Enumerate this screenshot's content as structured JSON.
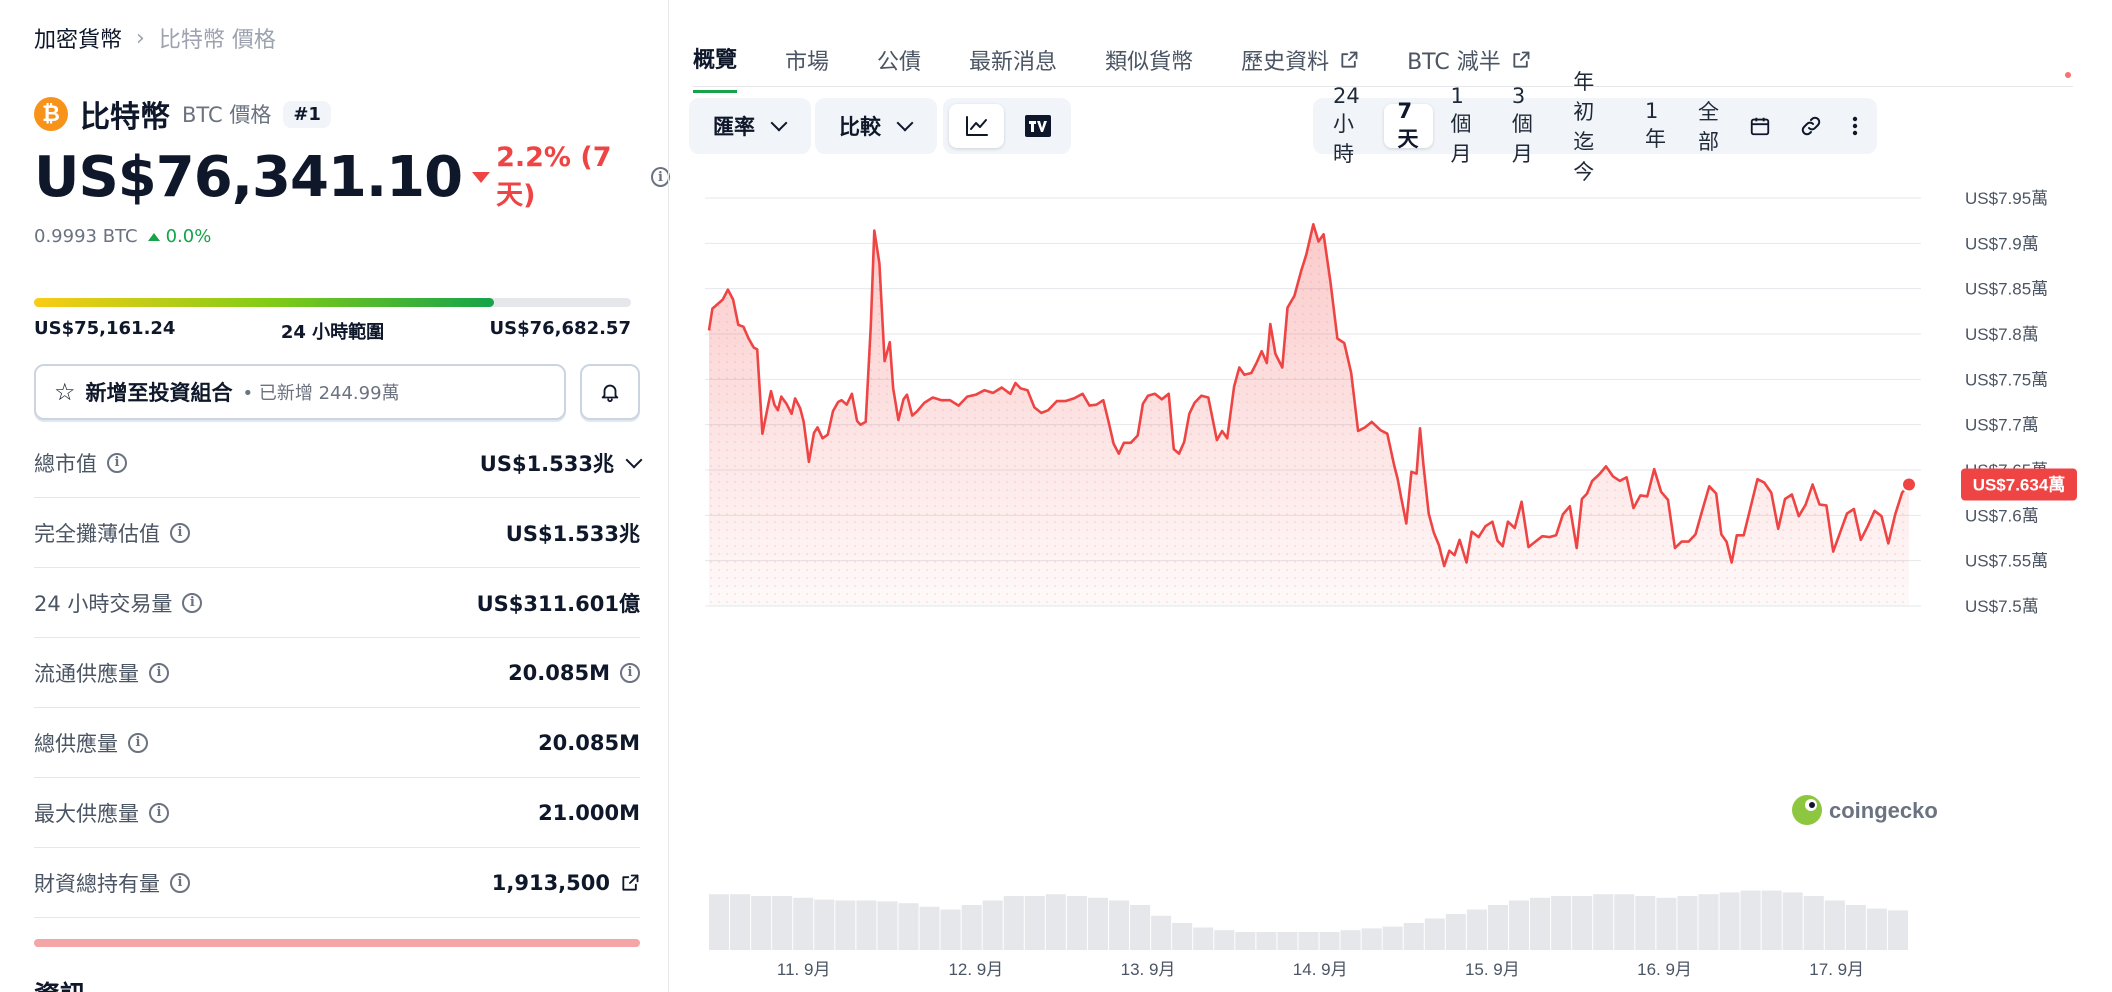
{
  "breadcrumb": {
    "root": "加密貨幣",
    "current": "比特幣 價格"
  },
  "coin": {
    "name": "比特幣",
    "symbol_label": "BTC 價格",
    "rank": "#1",
    "logo_glyph": "₿",
    "logo_color": "#f7931a"
  },
  "price": {
    "value": "US$76,341.10",
    "change": "2.2% (7天)",
    "change_color": "#ef4444"
  },
  "btc_price": {
    "value": "0.9993 BTC",
    "change": "0.0%",
    "change_color": "#16a34a"
  },
  "range_24h": {
    "low": "US$75,161.24",
    "label": "24 小時範圍",
    "high": "US$76,682.57",
    "position": 0.77
  },
  "portfolio": {
    "label": "新增至投資組合",
    "sub": "• 已新增 244.99萬"
  },
  "stats": [
    {
      "label": "總市值",
      "value": "US$1.533兆"
    },
    {
      "label": "完全攤薄估值",
      "value": "US$1.533兆"
    },
    {
      "label": "24 小時交易量",
      "value": "US$311.601億"
    },
    {
      "label": "流通供應量",
      "value": "20.085M"
    },
    {
      "label": "總供應量",
      "value": "20.085M"
    },
    {
      "label": "最大供應量",
      "value": "21.000M"
    },
    {
      "label": "財資總持有量",
      "value": "1,913,500"
    }
  ],
  "info_title": "資訊",
  "tabs": [
    {
      "label": "概覽",
      "active": true
    },
    {
      "label": "市場"
    },
    {
      "label": "公債"
    },
    {
      "label": "最新消息"
    },
    {
      "label": "類似貨幣"
    },
    {
      "label": "歷史資料",
      "external": true
    },
    {
      "label": "BTC 減半",
      "external": true
    }
  ],
  "controls": {
    "rate_label": "匯率",
    "compare_label": "比較",
    "chart_types": [
      "line-chart-icon",
      "tradingview-icon"
    ],
    "ranges": [
      "24小時",
      "7天",
      "1 個月",
      "3 個月",
      "年初迄今",
      "1年",
      "全部"
    ],
    "selected_range": "7天"
  },
  "chart_data": {
    "type": "area",
    "y_unit": "萬 USD",
    "ylim": [
      7.5,
      7.95
    ],
    "y_ticks": [
      "US$7.95萬",
      "US$7.9萬",
      "US$7.85萬",
      "US$7.8萬",
      "US$7.75萬",
      "US$7.7萬",
      "US$7.65萬",
      "US$7.6萬",
      "US$7.55萬",
      "US$7.5萬"
    ],
    "y_tick_values": [
      7.95,
      7.9,
      7.85,
      7.8,
      7.75,
      7.7,
      7.65,
      7.6,
      7.55,
      7.5
    ],
    "x_ticks": [
      "11. 9月",
      "12. 9月",
      "13. 9月",
      "14. 9月",
      "15. 9月",
      "16. 9月",
      "17. 9月"
    ],
    "x_tick_days": [
      11,
      12,
      13,
      14,
      15,
      16,
      17
    ],
    "x_range_days": [
      10.45,
      17.42
    ],
    "current_label": "US$7.634萬",
    "current_value": 7.634,
    "line_color": "#ef4444",
    "watermark": "coingecko",
    "series": [
      {
        "values": [
          [
            10.45,
            7.804
          ],
          [
            10.47,
            7.828
          ],
          [
            10.5,
            7.833
          ],
          [
            10.53,
            7.838
          ],
          [
            10.56,
            7.849
          ],
          [
            10.59,
            7.838
          ],
          [
            10.62,
            7.81
          ],
          [
            10.65,
            7.808
          ],
          [
            10.68,
            7.795
          ],
          [
            10.71,
            7.785
          ],
          [
            10.73,
            7.783
          ],
          [
            10.76,
            7.69
          ],
          [
            10.79,
            7.718
          ],
          [
            10.81,
            7.737
          ],
          [
            10.83,
            7.722
          ],
          [
            10.85,
            7.716
          ],
          [
            10.87,
            7.731
          ],
          [
            10.9,
            7.723
          ],
          [
            10.93,
            7.712
          ],
          [
            10.95,
            7.729
          ],
          [
            10.98,
            7.718
          ],
          [
            11.0,
            7.703
          ],
          [
            11.03,
            7.659
          ],
          [
            11.06,
            7.691
          ],
          [
            11.08,
            7.697
          ],
          [
            11.11,
            7.685
          ],
          [
            11.14,
            7.689
          ],
          [
            11.17,
            7.715
          ],
          [
            11.2,
            7.725
          ],
          [
            11.22,
            7.727
          ],
          [
            11.25,
            7.722
          ],
          [
            11.28,
            7.734
          ],
          [
            11.31,
            7.704
          ],
          [
            11.33,
            7.7
          ],
          [
            11.36,
            7.703
          ],
          [
            11.39,
            7.809
          ],
          [
            11.41,
            7.914
          ],
          [
            11.44,
            7.878
          ],
          [
            11.47,
            7.77
          ],
          [
            11.5,
            7.791
          ],
          [
            11.52,
            7.74
          ],
          [
            11.55,
            7.705
          ],
          [
            11.58,
            7.728
          ],
          [
            11.6,
            7.733
          ],
          [
            11.63,
            7.71
          ],
          [
            11.66,
            7.715
          ],
          [
            11.7,
            7.724
          ],
          [
            11.75,
            7.73
          ],
          [
            11.8,
            7.727
          ],
          [
            11.85,
            7.727
          ],
          [
            11.9,
            7.721
          ],
          [
            11.95,
            7.731
          ],
          [
            12.0,
            7.733
          ],
          [
            12.05,
            7.738
          ],
          [
            12.1,
            7.735
          ],
          [
            12.15,
            7.741
          ],
          [
            12.2,
            7.734
          ],
          [
            12.23,
            7.746
          ],
          [
            12.26,
            7.74
          ],
          [
            12.3,
            7.738
          ],
          [
            12.34,
            7.719
          ],
          [
            12.38,
            7.713
          ],
          [
            12.42,
            7.716
          ],
          [
            12.47,
            7.726
          ],
          [
            12.52,
            7.726
          ],
          [
            12.57,
            7.729
          ],
          [
            12.62,
            7.734
          ],
          [
            12.66,
            7.721
          ],
          [
            12.7,
            7.722
          ],
          [
            12.74,
            7.727
          ],
          [
            12.77,
            7.704
          ],
          [
            12.8,
            7.679
          ],
          [
            12.83,
            7.668
          ],
          [
            12.86,
            7.68
          ],
          [
            12.9,
            7.68
          ],
          [
            12.94,
            7.688
          ],
          [
            12.97,
            7.723
          ],
          [
            13.0,
            7.732
          ],
          [
            13.04,
            7.734
          ],
          [
            13.08,
            7.728
          ],
          [
            13.12,
            7.734
          ],
          [
            13.15,
            7.673
          ],
          [
            13.18,
            7.668
          ],
          [
            13.21,
            7.681
          ],
          [
            13.24,
            7.712
          ],
          [
            13.27,
            7.724
          ],
          [
            13.31,
            7.732
          ],
          [
            13.35,
            7.73
          ],
          [
            13.4,
            7.683
          ],
          [
            13.43,
            7.693
          ],
          [
            13.46,
            7.685
          ],
          [
            13.5,
            7.742
          ],
          [
            13.53,
            7.763
          ],
          [
            13.56,
            7.755
          ],
          [
            13.6,
            7.757
          ],
          [
            13.63,
            7.768
          ],
          [
            13.66,
            7.781
          ],
          [
            13.69,
            7.768
          ],
          [
            13.71,
            7.811
          ],
          [
            13.74,
            7.778
          ],
          [
            13.78,
            7.763
          ],
          [
            13.81,
            7.829
          ],
          [
            13.85,
            7.842
          ],
          [
            13.89,
            7.87
          ],
          [
            13.92,
            7.888
          ],
          [
            13.96,
            7.921
          ],
          [
            13.99,
            7.902
          ],
          [
            14.02,
            7.91
          ],
          [
            14.06,
            7.857
          ],
          [
            14.1,
            7.795
          ],
          [
            14.14,
            7.79
          ],
          [
            14.18,
            7.757
          ],
          [
            14.22,
            7.693
          ],
          [
            14.26,
            7.697
          ],
          [
            14.3,
            7.703
          ],
          [
            14.35,
            7.694
          ],
          [
            14.39,
            7.69
          ],
          [
            14.43,
            7.655
          ],
          [
            14.45,
            7.64
          ],
          [
            14.47,
            7.62
          ],
          [
            14.5,
            7.591
          ],
          [
            14.53,
            7.648
          ],
          [
            14.56,
            7.646
          ],
          [
            14.58,
            7.696
          ],
          [
            14.6,
            7.655
          ],
          [
            14.63,
            7.602
          ],
          [
            14.66,
            7.581
          ],
          [
            14.69,
            7.567
          ],
          [
            14.72,
            7.544
          ],
          [
            14.75,
            7.561
          ],
          [
            14.78,
            7.556
          ],
          [
            14.81,
            7.573
          ],
          [
            14.85,
            7.548
          ],
          [
            14.88,
            7.582
          ],
          [
            14.92,
            7.576
          ],
          [
            14.96,
            7.588
          ],
          [
            15.0,
            7.593
          ],
          [
            15.03,
            7.572
          ],
          [
            15.06,
            7.566
          ],
          [
            15.09,
            7.593
          ],
          [
            15.13,
            7.586
          ],
          [
            15.17,
            7.615
          ],
          [
            15.21,
            7.565
          ],
          [
            15.25,
            7.571
          ],
          [
            15.29,
            7.577
          ],
          [
            15.33,
            7.576
          ],
          [
            15.37,
            7.578
          ],
          [
            15.41,
            7.601
          ],
          [
            15.45,
            7.61
          ],
          [
            15.49,
            7.564
          ],
          [
            15.52,
            7.618
          ],
          [
            15.55,
            7.624
          ],
          [
            15.58,
            7.638
          ],
          [
            15.62,
            7.645
          ],
          [
            15.66,
            7.654
          ],
          [
            15.7,
            7.643
          ],
          [
            15.74,
            7.638
          ],
          [
            15.78,
            7.642
          ],
          [
            15.82,
            7.608
          ],
          [
            15.86,
            7.622
          ],
          [
            15.9,
            7.621
          ],
          [
            15.94,
            7.651
          ],
          [
            15.98,
            7.626
          ],
          [
            16.02,
            7.617
          ],
          [
            16.06,
            7.564
          ],
          [
            16.1,
            7.571
          ],
          [
            16.14,
            7.571
          ],
          [
            16.18,
            7.579
          ],
          [
            16.22,
            7.606
          ],
          [
            16.26,
            7.632
          ],
          [
            16.3,
            7.624
          ],
          [
            16.33,
            7.579
          ],
          [
            16.36,
            7.571
          ],
          [
            16.39,
            7.548
          ],
          [
            16.42,
            7.578
          ],
          [
            16.46,
            7.578
          ],
          [
            16.5,
            7.609
          ],
          [
            16.54,
            7.64
          ],
          [
            16.58,
            7.636
          ],
          [
            16.62,
            7.625
          ],
          [
            16.66,
            7.585
          ],
          [
            16.7,
            7.618
          ],
          [
            16.74,
            7.623
          ],
          [
            16.78,
            7.599
          ],
          [
            16.82,
            7.612
          ],
          [
            16.86,
            7.634
          ],
          [
            16.9,
            7.612
          ],
          [
            16.94,
            7.611
          ],
          [
            16.98,
            7.56
          ],
          [
            17.02,
            7.581
          ],
          [
            17.06,
            7.602
          ],
          [
            17.1,
            7.607
          ],
          [
            17.14,
            7.573
          ],
          [
            17.18,
            7.588
          ],
          [
            17.22,
            7.605
          ],
          [
            17.26,
            7.599
          ],
          [
            17.3,
            7.569
          ],
          [
            17.34,
            7.601
          ],
          [
            17.38,
            7.625
          ],
          [
            17.42,
            7.634
          ]
        ]
      }
    ],
    "volume_level": [
      0.62,
      0.62,
      0.6,
      0.6,
      0.58,
      0.56,
      0.55,
      0.55,
      0.54,
      0.52,
      0.48,
      0.45,
      0.5,
      0.55,
      0.6,
      0.6,
      0.62,
      0.6,
      0.58,
      0.55,
      0.5,
      0.38,
      0.3,
      0.25,
      0.22,
      0.2,
      0.2,
      0.2,
      0.2,
      0.2,
      0.22,
      0.24,
      0.26,
      0.3,
      0.35,
      0.4,
      0.45,
      0.5,
      0.55,
      0.58,
      0.6,
      0.6,
      0.62,
      0.62,
      0.6,
      0.58,
      0.6,
      0.62,
      0.64,
      0.66,
      0.66,
      0.64,
      0.6,
      0.55,
      0.5,
      0.46,
      0.44
    ]
  }
}
